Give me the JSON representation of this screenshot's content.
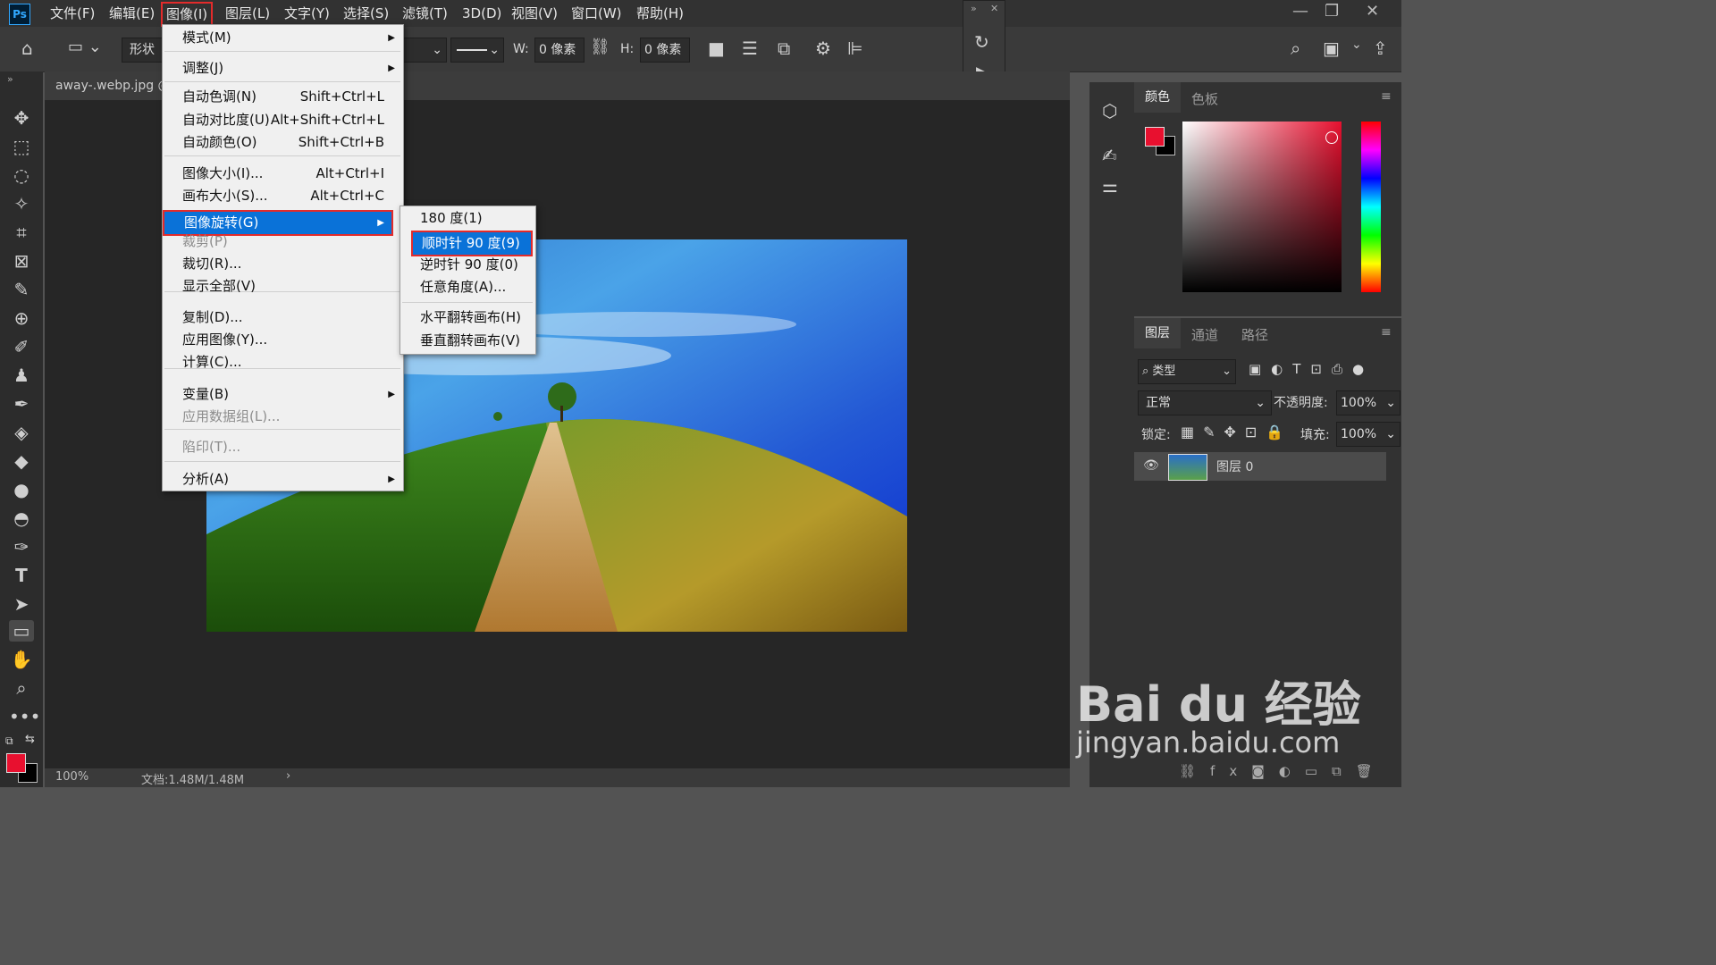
{
  "app": {
    "logo": "Ps"
  },
  "menubar": [
    "文件(F)",
    "编辑(E)",
    "图像(I)",
    "图层(L)",
    "文字(Y)",
    "选择(S)",
    "滤镜(T)",
    "3D(D)",
    "视图(V)",
    "窗口(W)",
    "帮助(H)"
  ],
  "options": {
    "shape_mode": "形状",
    "w_label": "W:",
    "w_value": "0 像素",
    "h_label": "H:",
    "h_value": "0 像素"
  },
  "doc": {
    "tab_title": "away-.webp.jpg @",
    "zoom": "100%",
    "doc_size": "文档:1.48M/1.48M"
  },
  "image_menu": {
    "items": [
      {
        "label": "模式(M)",
        "shortcut": "",
        "submenu": true,
        "disabled": false
      },
      {
        "label": "调整(J)",
        "shortcut": "",
        "submenu": true,
        "disabled": false
      },
      {
        "label": "自动色调(N)",
        "shortcut": "Shift+Ctrl+L",
        "submenu": false,
        "disabled": false
      },
      {
        "label": "自动对比度(U)",
        "shortcut": "Alt+Shift+Ctrl+L",
        "submenu": false,
        "disabled": false
      },
      {
        "label": "自动颜色(O)",
        "shortcut": "Shift+Ctrl+B",
        "submenu": false,
        "disabled": false
      },
      {
        "label": "图像大小(I)...",
        "shortcut": "Alt+Ctrl+I",
        "submenu": false,
        "disabled": false
      },
      {
        "label": "画布大小(S)...",
        "shortcut": "Alt+Ctrl+C",
        "submenu": false,
        "disabled": false
      },
      {
        "label": "图像旋转(G)",
        "shortcut": "",
        "submenu": true,
        "disabled": false,
        "highlighted": true
      },
      {
        "label": "裁剪(P)",
        "shortcut": "",
        "submenu": false,
        "disabled": true
      },
      {
        "label": "裁切(R)...",
        "shortcut": "",
        "submenu": false,
        "disabled": false
      },
      {
        "label": "显示全部(V)",
        "shortcut": "",
        "submenu": false,
        "disabled": false
      },
      {
        "label": "复制(D)...",
        "shortcut": "",
        "submenu": false,
        "disabled": false
      },
      {
        "label": "应用图像(Y)...",
        "shortcut": "",
        "submenu": false,
        "disabled": false
      },
      {
        "label": "计算(C)...",
        "shortcut": "",
        "submenu": false,
        "disabled": false
      },
      {
        "label": "变量(B)",
        "shortcut": "",
        "submenu": true,
        "disabled": false
      },
      {
        "label": "应用数据组(L)...",
        "shortcut": "",
        "submenu": false,
        "disabled": true
      },
      {
        "label": "陷印(T)...",
        "shortcut": "",
        "submenu": false,
        "disabled": true
      },
      {
        "label": "分析(A)",
        "shortcut": "",
        "submenu": true,
        "disabled": false
      }
    ]
  },
  "rotate_submenu": {
    "items": [
      {
        "label": "180 度(1)"
      },
      {
        "label": "顺时针 90 度(9)",
        "highlighted": true
      },
      {
        "label": "逆时针 90 度(0)"
      },
      {
        "label": "任意角度(A)..."
      },
      {
        "label": "水平翻转画布(H)"
      },
      {
        "label": "垂直翻转画布(V)"
      }
    ]
  },
  "color_panel": {
    "tabs": [
      "颜色",
      "色板"
    ],
    "fg_color": "#e8102f",
    "bg_color": "#000000"
  },
  "layers_panel": {
    "tabs": [
      "图层",
      "通道",
      "路径"
    ],
    "filter_kind": "类型",
    "blend_mode": "正常",
    "opacity_label": "不透明度:",
    "opacity_value": "100%",
    "lock_label": "锁定:",
    "fill_label": "填充:",
    "fill_value": "100%",
    "layer_name": "图层 0"
  },
  "watermark": {
    "brand": "Bai du 经验",
    "url": "jingyan.baidu.com"
  },
  "accent": "#0a72d8",
  "highlight_box": "#e32b2b"
}
